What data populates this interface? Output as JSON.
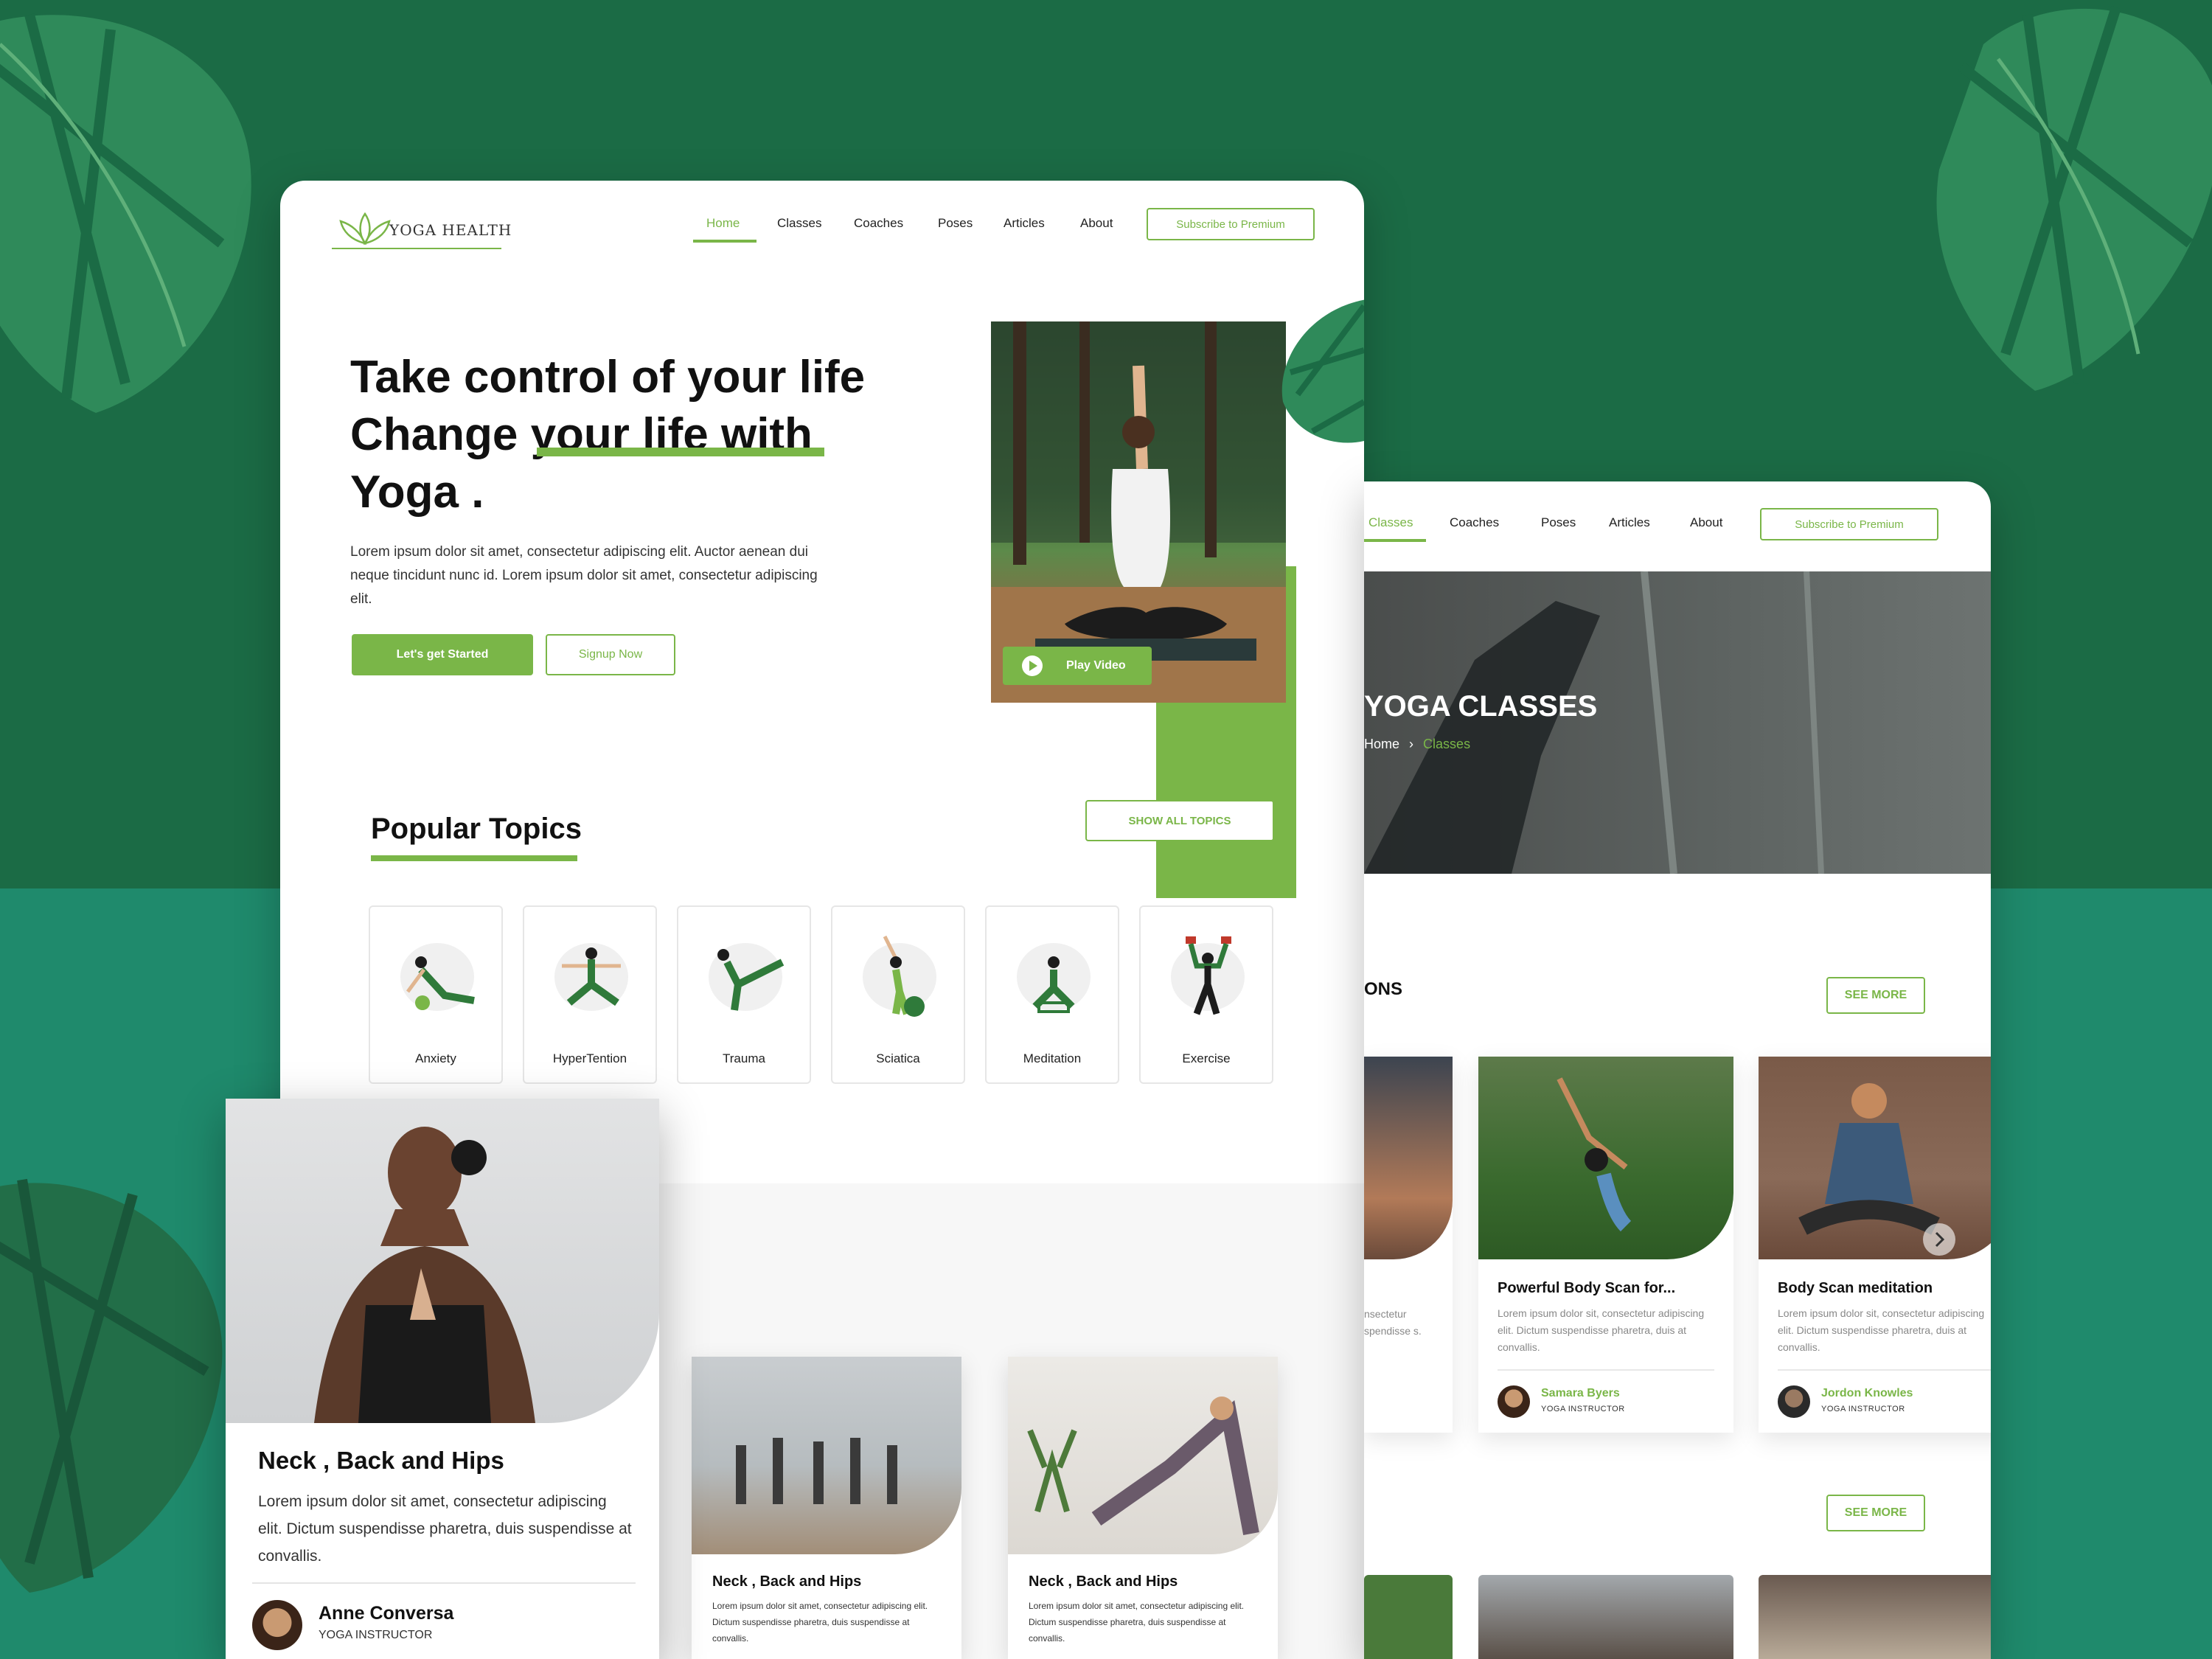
{
  "brand": {
    "name": "YOGA HEALTH",
    "accent": "#7ab648",
    "bg_dark": "#1b6b45",
    "bg_light": "#1f8a6c"
  },
  "nav": {
    "items": [
      "Home",
      "Classes",
      "Coaches",
      "Poses",
      "Articles",
      "About"
    ],
    "cta": "Subscribe to Premium"
  },
  "hero": {
    "line1": "Take control of your life",
    "line2": "Change your life with",
    "line3": "Yoga .",
    "desc": "Lorem ipsum dolor sit amet, consectetur adipiscing elit. Auctor aenean dui neque tincidunt nunc id. Lorem ipsum dolor sit amet, consectetur adipiscing elit.",
    "primary_btn": "Let's get Started",
    "secondary_btn": "Signup Now",
    "video_btn": "Play Video"
  },
  "topics": {
    "title": "Popular Topics",
    "show_all": "SHOW ALL TOPICS",
    "items": [
      "Anxiety",
      "HyperTention",
      "Trauma",
      "Sciatica",
      "Meditation",
      "Exercise"
    ]
  },
  "classes_page": {
    "nav": [
      "Classes",
      "Coaches",
      "Poses",
      "Articles",
      "About"
    ],
    "cta": "Subscribe to Premium",
    "banner_title": "YOGA CLASSES",
    "breadcrumb_home": "Home",
    "breadcrumb_sep": "›",
    "breadcrumb_current": "Classes",
    "section_title_partial": "ONS",
    "see_more": "SEE MORE",
    "see_more_2": "SEE MORE",
    "cards": [
      {
        "title": "Powerful Body Scan for...",
        "text": "Lorem ipsum dolor sit, consectetur adipiscing elit. Dictum suspendisse pharetra, duis at convallis.",
        "author": "Samara Byers",
        "role": "YOGA INSTRUCTOR"
      },
      {
        "title": "Body Scan meditation",
        "text": "Lorem ipsum dolor sit, consectetur adipiscing elit. Dictum suspendisse pharetra, duis at convallis.",
        "author": "Jordon Knowles",
        "role": "YOGA INSTRUCTOR"
      }
    ],
    "partial_text": "nsectetur spendisse s."
  },
  "neck_card": {
    "title": "Neck , Back and Hips",
    "text": "Lorem ipsum dolor sit amet, consectetur adipiscing elit. Dictum suspendisse pharetra, duis suspendisse at convallis.",
    "author": "Anne Conversa",
    "role": "YOGA INSTRUCTOR"
  },
  "small_cards": [
    {
      "title": "Neck , Back and Hips",
      "text": "Lorem ipsum dolor sit amet, consectetur adipiscing elit. Dictum suspendisse pharetra, duis suspendisse at convallis."
    },
    {
      "title": "Neck , Back and Hips",
      "text": "Lorem ipsum dolor sit amet, consectetur adipiscing elit. Dictum suspendisse pharetra, duis suspendisse at convallis."
    }
  ]
}
